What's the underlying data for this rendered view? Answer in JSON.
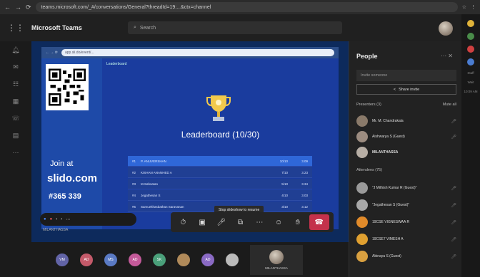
{
  "browser": {
    "url": "teams.microsoft.com/_#/conversations/General?threadId=19:...&ctx=channel"
  },
  "teams": {
    "title": "Microsoft Teams",
    "search_placeholder": "Search"
  },
  "shared": {
    "tab_label": "Leaderboard",
    "inner_url": "app.sli.do/event/...",
    "join_at": "Join at",
    "slido": "slido.com",
    "code": "#365 339",
    "title": "Leaderboard (10/30)",
    "rows": [
      {
        "rank": "#1",
        "name": "P. ANUVERSHAN",
        "score": "10/10",
        "time": "3.09"
      },
      {
        "rank": "#2",
        "name": "KISHAN ANANHED A",
        "score": "7/10",
        "time": "3.23"
      },
      {
        "rank": "#3",
        "name": "M.Sahsatan",
        "score": "5/10",
        "time": "3.34"
      },
      {
        "rank": "#4",
        "name": "Jegathesan S",
        "score": "4/10",
        "time": "3.03"
      },
      {
        "rank": "#5",
        "name": "Samuelthasbathan Saravanan",
        "score": "3/10",
        "time": "3.12"
      }
    ],
    "tooltip": "Stop slideshow to resume",
    "you_badge": "MILANTHASSA"
  },
  "people": {
    "title": "People",
    "invite_placeholder": "Invite someone",
    "share_invite": "Share invite",
    "presenters_label": "Presenters (3)",
    "mute_all": "Mute all",
    "presenters": [
      {
        "name": "Mr. M. Chandrakala"
      },
      {
        "name": "Aishwarya S (Guest)"
      },
      {
        "name": "MILANTHASSA"
      }
    ],
    "attendees_label": "Attendees (75)",
    "attendees": [
      {
        "name": "\"J Mithish Kumar R (Guest)\""
      },
      {
        "name": "\"Jegathesan S (Guest)\""
      },
      {
        "name": "19CSE VIGNESWAA R"
      },
      {
        "name": "19CSE7 VIMESH A"
      },
      {
        "name": "Abinaya S (Guest)"
      }
    ]
  },
  "right_rail": {
    "label_1": "Staff",
    "label_2": "Wait",
    "time": "10:09 AM"
  },
  "bottom": {
    "avatars": [
      "VM",
      "AD",
      "MS",
      "AD",
      "SK",
      "",
      "AD",
      ""
    ],
    "tile_name": "MILANTHASSA"
  },
  "colors": {
    "accent": "#6264a7",
    "hangup": "#c4314b",
    "slide_blue": "#1a3c9e"
  }
}
